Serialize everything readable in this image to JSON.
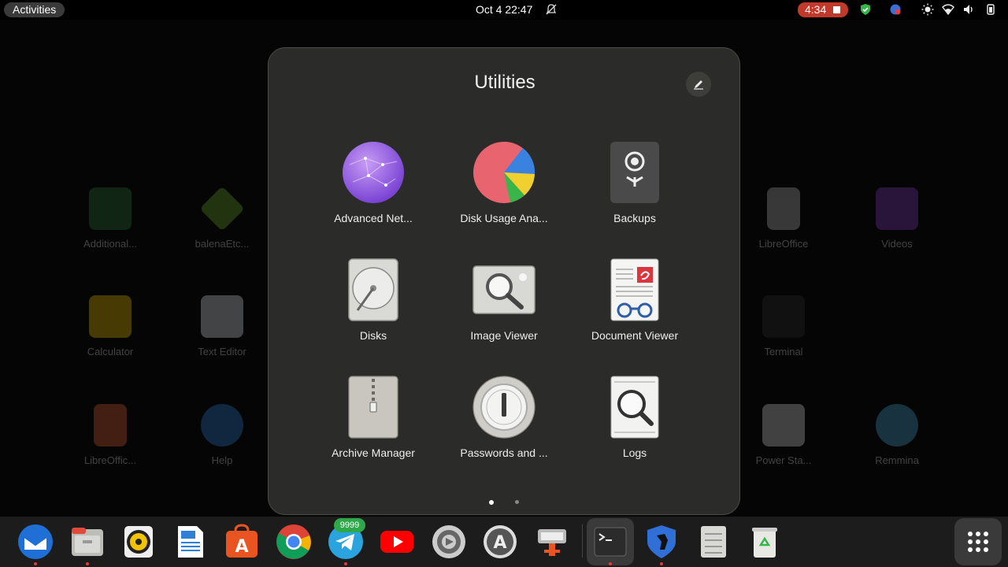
{
  "topbar": {
    "activities_label": "Activities",
    "clock": "Oct 4  22:47",
    "recording_time": "4:34"
  },
  "background_apps": [
    {
      "label": "Additional..."
    },
    {
      "label": "balenaEtc..."
    },
    {
      "label": "LibreOffice"
    },
    {
      "label": "Videos"
    },
    {
      "label": "Calculator"
    },
    {
      "label": "Text Editor"
    },
    {
      "label": "Terminal"
    },
    {
      "label": "LibreOffic..."
    },
    {
      "label": "Help"
    },
    {
      "label": "Power Sta..."
    },
    {
      "label": "Remmina"
    }
  ],
  "folder": {
    "title": "Utilities",
    "apps": [
      {
        "label": "Advanced Net...",
        "icon": "advanced-network-icon"
      },
      {
        "label": "Disk Usage Ana...",
        "icon": "disk-usage-pie-icon"
      },
      {
        "label": "Backups",
        "icon": "backups-safe-icon"
      },
      {
        "label": "Disks",
        "icon": "disks-icon"
      },
      {
        "label": "Image Viewer",
        "icon": "image-viewer-icon"
      },
      {
        "label": "Document Viewer",
        "icon": "document-viewer-icon"
      },
      {
        "label": "Archive Manager",
        "icon": "archive-manager-icon"
      },
      {
        "label": "Passwords and ...",
        "icon": "passwords-keys-icon"
      },
      {
        "label": "Logs",
        "icon": "logs-icon"
      }
    ],
    "pages": 2,
    "current_page": 1
  },
  "dock": {
    "telegram_badge": "9999",
    "items": [
      "thunderbird-icon",
      "files-icon",
      "rhythmbox-icon",
      "libreoffice-writer-icon",
      "app-center-icon",
      "chrome-icon",
      "telegram-icon",
      "youtube-icon",
      "settings-icon",
      "software-updater-icon",
      "screenshot-tool-icon",
      "terminal-icon",
      "guardian-icon",
      "file-list-icon",
      "trash-icon"
    ]
  },
  "colors": {
    "accent": "#e95420",
    "record": "#c0392b",
    "folder_bg": "#2b2b29"
  }
}
